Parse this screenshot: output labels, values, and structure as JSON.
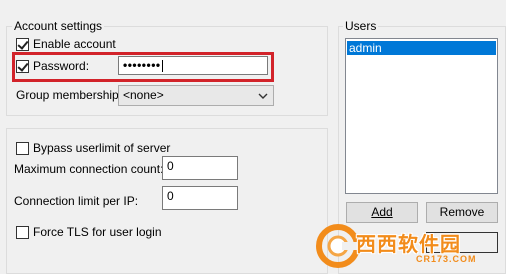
{
  "account_settings": {
    "legend": "Account settings",
    "enable_account": {
      "label": "Enable account",
      "checked": true
    },
    "password": {
      "label": "Password:",
      "checked": true,
      "value": "••••••••"
    },
    "group_membership": {
      "label": "Group membership:",
      "value": "<none>"
    }
  },
  "limits": {
    "bypass_userlimit": {
      "label": "Bypass userlimit of server",
      "checked": false
    },
    "max_connection_count": {
      "label": "Maximum connection count:",
      "value": "0"
    },
    "connection_limit_per_ip": {
      "label": "Connection limit per IP:",
      "value": "0"
    },
    "force_tls": {
      "label": "Force TLS for user login",
      "checked": false
    }
  },
  "users": {
    "legend": "Users",
    "items": [
      "admin"
    ],
    "add_label": "Add",
    "remove_label": "Remove"
  },
  "watermark": {
    "logo_text": "西西软件园",
    "url_text": "CR173.COM"
  },
  "colors": {
    "selection": "#0078d7",
    "highlight_box": "#d2232a",
    "logo_orange": "#f28c1b"
  }
}
